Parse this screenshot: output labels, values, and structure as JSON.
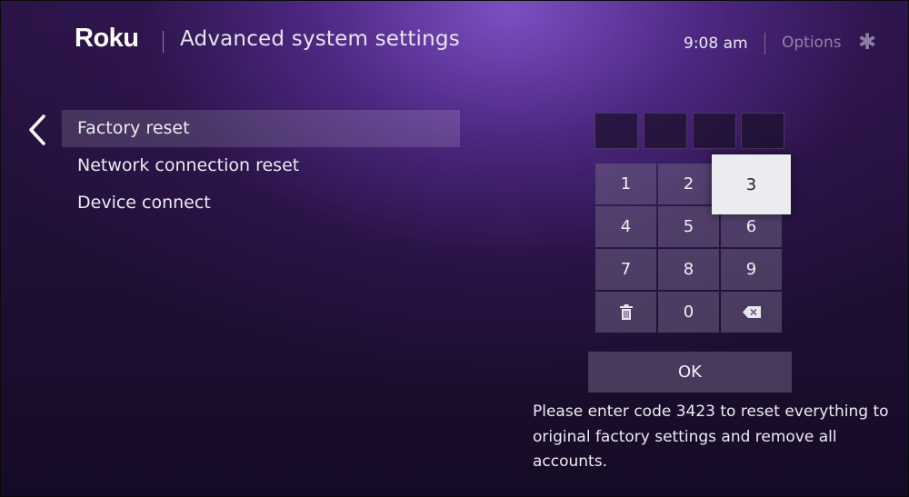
{
  "header": {
    "logo": "Roku",
    "title": "Advanced system settings",
    "time": "9:08 am",
    "options_label": "Options",
    "options_icon": "✱"
  },
  "menu": {
    "items": [
      {
        "label": "Factory reset",
        "selected": true
      },
      {
        "label": "Network connection reset",
        "selected": false
      },
      {
        "label": "Device connect",
        "selected": false
      }
    ]
  },
  "keypad": {
    "keys": [
      "1",
      "2",
      "3",
      "4",
      "5",
      "6",
      "7",
      "8",
      "9",
      "trash-icon",
      "0",
      "backspace-icon"
    ],
    "focused_key": "3",
    "ok_label": "OK"
  },
  "code_entry": {
    "box_count": 4
  },
  "instructions": "Please enter code 3423 to reset everything to original factory settings and remove all accounts.",
  "colors": {
    "background_accent": "#7a4fc4",
    "key_background": "#6e6082",
    "focused_key_background": "#ecebef"
  }
}
